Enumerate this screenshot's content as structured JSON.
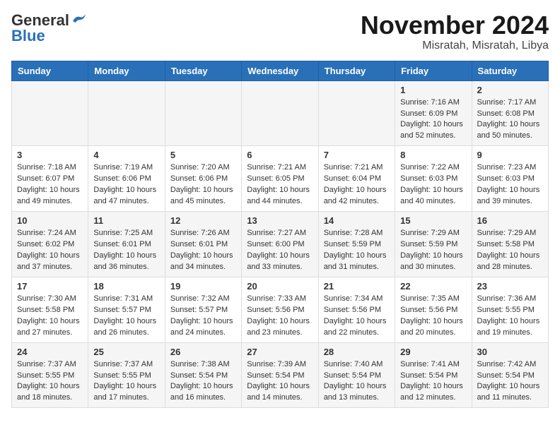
{
  "header": {
    "logo_line1": "General",
    "logo_line2": "Blue",
    "month": "November 2024",
    "location": "Misratah, Misratah, Libya"
  },
  "weekdays": [
    "Sunday",
    "Monday",
    "Tuesday",
    "Wednesday",
    "Thursday",
    "Friday",
    "Saturday"
  ],
  "weeks": [
    [
      {
        "day": "",
        "info": ""
      },
      {
        "day": "",
        "info": ""
      },
      {
        "day": "",
        "info": ""
      },
      {
        "day": "",
        "info": ""
      },
      {
        "day": "",
        "info": ""
      },
      {
        "day": "1",
        "info": "Sunrise: 7:16 AM\nSunset: 6:09 PM\nDaylight: 10 hours\nand 52 minutes."
      },
      {
        "day": "2",
        "info": "Sunrise: 7:17 AM\nSunset: 6:08 PM\nDaylight: 10 hours\nand 50 minutes."
      }
    ],
    [
      {
        "day": "3",
        "info": "Sunrise: 7:18 AM\nSunset: 6:07 PM\nDaylight: 10 hours\nand 49 minutes."
      },
      {
        "day": "4",
        "info": "Sunrise: 7:19 AM\nSunset: 6:06 PM\nDaylight: 10 hours\nand 47 minutes."
      },
      {
        "day": "5",
        "info": "Sunrise: 7:20 AM\nSunset: 6:06 PM\nDaylight: 10 hours\nand 45 minutes."
      },
      {
        "day": "6",
        "info": "Sunrise: 7:21 AM\nSunset: 6:05 PM\nDaylight: 10 hours\nand 44 minutes."
      },
      {
        "day": "7",
        "info": "Sunrise: 7:21 AM\nSunset: 6:04 PM\nDaylight: 10 hours\nand 42 minutes."
      },
      {
        "day": "8",
        "info": "Sunrise: 7:22 AM\nSunset: 6:03 PM\nDaylight: 10 hours\nand 40 minutes."
      },
      {
        "day": "9",
        "info": "Sunrise: 7:23 AM\nSunset: 6:03 PM\nDaylight: 10 hours\nand 39 minutes."
      }
    ],
    [
      {
        "day": "10",
        "info": "Sunrise: 7:24 AM\nSunset: 6:02 PM\nDaylight: 10 hours\nand 37 minutes."
      },
      {
        "day": "11",
        "info": "Sunrise: 7:25 AM\nSunset: 6:01 PM\nDaylight: 10 hours\nand 36 minutes."
      },
      {
        "day": "12",
        "info": "Sunrise: 7:26 AM\nSunset: 6:01 PM\nDaylight: 10 hours\nand 34 minutes."
      },
      {
        "day": "13",
        "info": "Sunrise: 7:27 AM\nSunset: 6:00 PM\nDaylight: 10 hours\nand 33 minutes."
      },
      {
        "day": "14",
        "info": "Sunrise: 7:28 AM\nSunset: 5:59 PM\nDaylight: 10 hours\nand 31 minutes."
      },
      {
        "day": "15",
        "info": "Sunrise: 7:29 AM\nSunset: 5:59 PM\nDaylight: 10 hours\nand 30 minutes."
      },
      {
        "day": "16",
        "info": "Sunrise: 7:29 AM\nSunset: 5:58 PM\nDaylight: 10 hours\nand 28 minutes."
      }
    ],
    [
      {
        "day": "17",
        "info": "Sunrise: 7:30 AM\nSunset: 5:58 PM\nDaylight: 10 hours\nand 27 minutes."
      },
      {
        "day": "18",
        "info": "Sunrise: 7:31 AM\nSunset: 5:57 PM\nDaylight: 10 hours\nand 26 minutes."
      },
      {
        "day": "19",
        "info": "Sunrise: 7:32 AM\nSunset: 5:57 PM\nDaylight: 10 hours\nand 24 minutes."
      },
      {
        "day": "20",
        "info": "Sunrise: 7:33 AM\nSunset: 5:56 PM\nDaylight: 10 hours\nand 23 minutes."
      },
      {
        "day": "21",
        "info": "Sunrise: 7:34 AM\nSunset: 5:56 PM\nDaylight: 10 hours\nand 22 minutes."
      },
      {
        "day": "22",
        "info": "Sunrise: 7:35 AM\nSunset: 5:56 PM\nDaylight: 10 hours\nand 20 minutes."
      },
      {
        "day": "23",
        "info": "Sunrise: 7:36 AM\nSunset: 5:55 PM\nDaylight: 10 hours\nand 19 minutes."
      }
    ],
    [
      {
        "day": "24",
        "info": "Sunrise: 7:37 AM\nSunset: 5:55 PM\nDaylight: 10 hours\nand 18 minutes."
      },
      {
        "day": "25",
        "info": "Sunrise: 7:37 AM\nSunset: 5:55 PM\nDaylight: 10 hours\nand 17 minutes."
      },
      {
        "day": "26",
        "info": "Sunrise: 7:38 AM\nSunset: 5:54 PM\nDaylight: 10 hours\nand 16 minutes."
      },
      {
        "day": "27",
        "info": "Sunrise: 7:39 AM\nSunset: 5:54 PM\nDaylight: 10 hours\nand 14 minutes."
      },
      {
        "day": "28",
        "info": "Sunrise: 7:40 AM\nSunset: 5:54 PM\nDaylight: 10 hours\nand 13 minutes."
      },
      {
        "day": "29",
        "info": "Sunrise: 7:41 AM\nSunset: 5:54 PM\nDaylight: 10 hours\nand 12 minutes."
      },
      {
        "day": "30",
        "info": "Sunrise: 7:42 AM\nSunset: 5:54 PM\nDaylight: 10 hours\nand 11 minutes."
      }
    ]
  ]
}
